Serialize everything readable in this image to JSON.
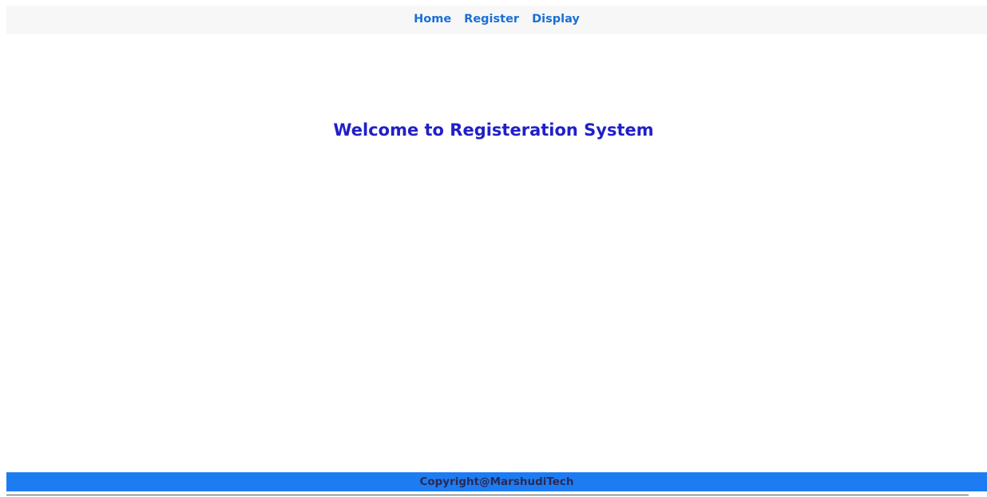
{
  "navbar": {
    "links": [
      {
        "label": "Home"
      },
      {
        "label": "Register"
      },
      {
        "label": "Display"
      }
    ]
  },
  "main": {
    "heading": "Welcome to Registeration System"
  },
  "footer": {
    "text": "Copyright@MarshudiTech"
  },
  "colors": {
    "nav_link": "#1a6fd6",
    "heading": "#2020c8",
    "footer_bg": "#1e7cf2",
    "navbar_bg": "#f7f7f7"
  }
}
